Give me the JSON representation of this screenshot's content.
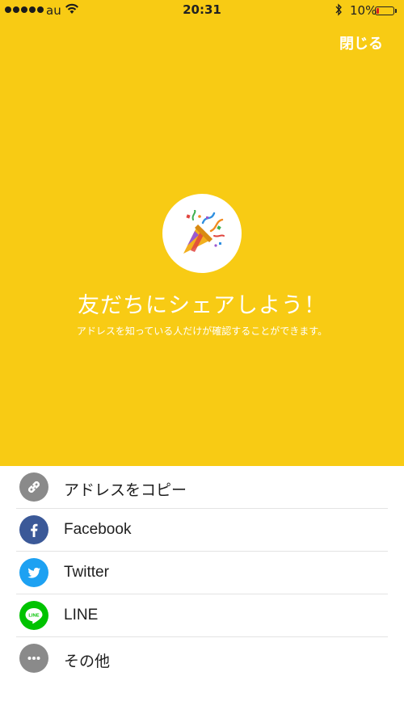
{
  "status_bar": {
    "carrier": "au",
    "time": "20:31",
    "battery_percent": "10%",
    "battery_level": 0.1,
    "signal_bars": 5
  },
  "header": {
    "close_label": "閉じる"
  },
  "hero": {
    "background_color": "#F8CB14",
    "emoji": "party-popper-icon",
    "headline": "友だちにシェアしよう！",
    "subline": "アドレスを知っている人だけが確認することができます。"
  },
  "share_options": [
    {
      "label": "アドレスをコピー",
      "icon": "link-icon",
      "color": "#8a8a8a"
    },
    {
      "label": "Facebook",
      "icon": "facebook-icon",
      "color": "#3b5998"
    },
    {
      "label": "Twitter",
      "icon": "twitter-icon",
      "color": "#1da1f2"
    },
    {
      "label": "LINE",
      "icon": "line-icon",
      "color": "#00c300"
    },
    {
      "label": "その他",
      "icon": "more-icon",
      "color": "#8a8a8a"
    }
  ]
}
